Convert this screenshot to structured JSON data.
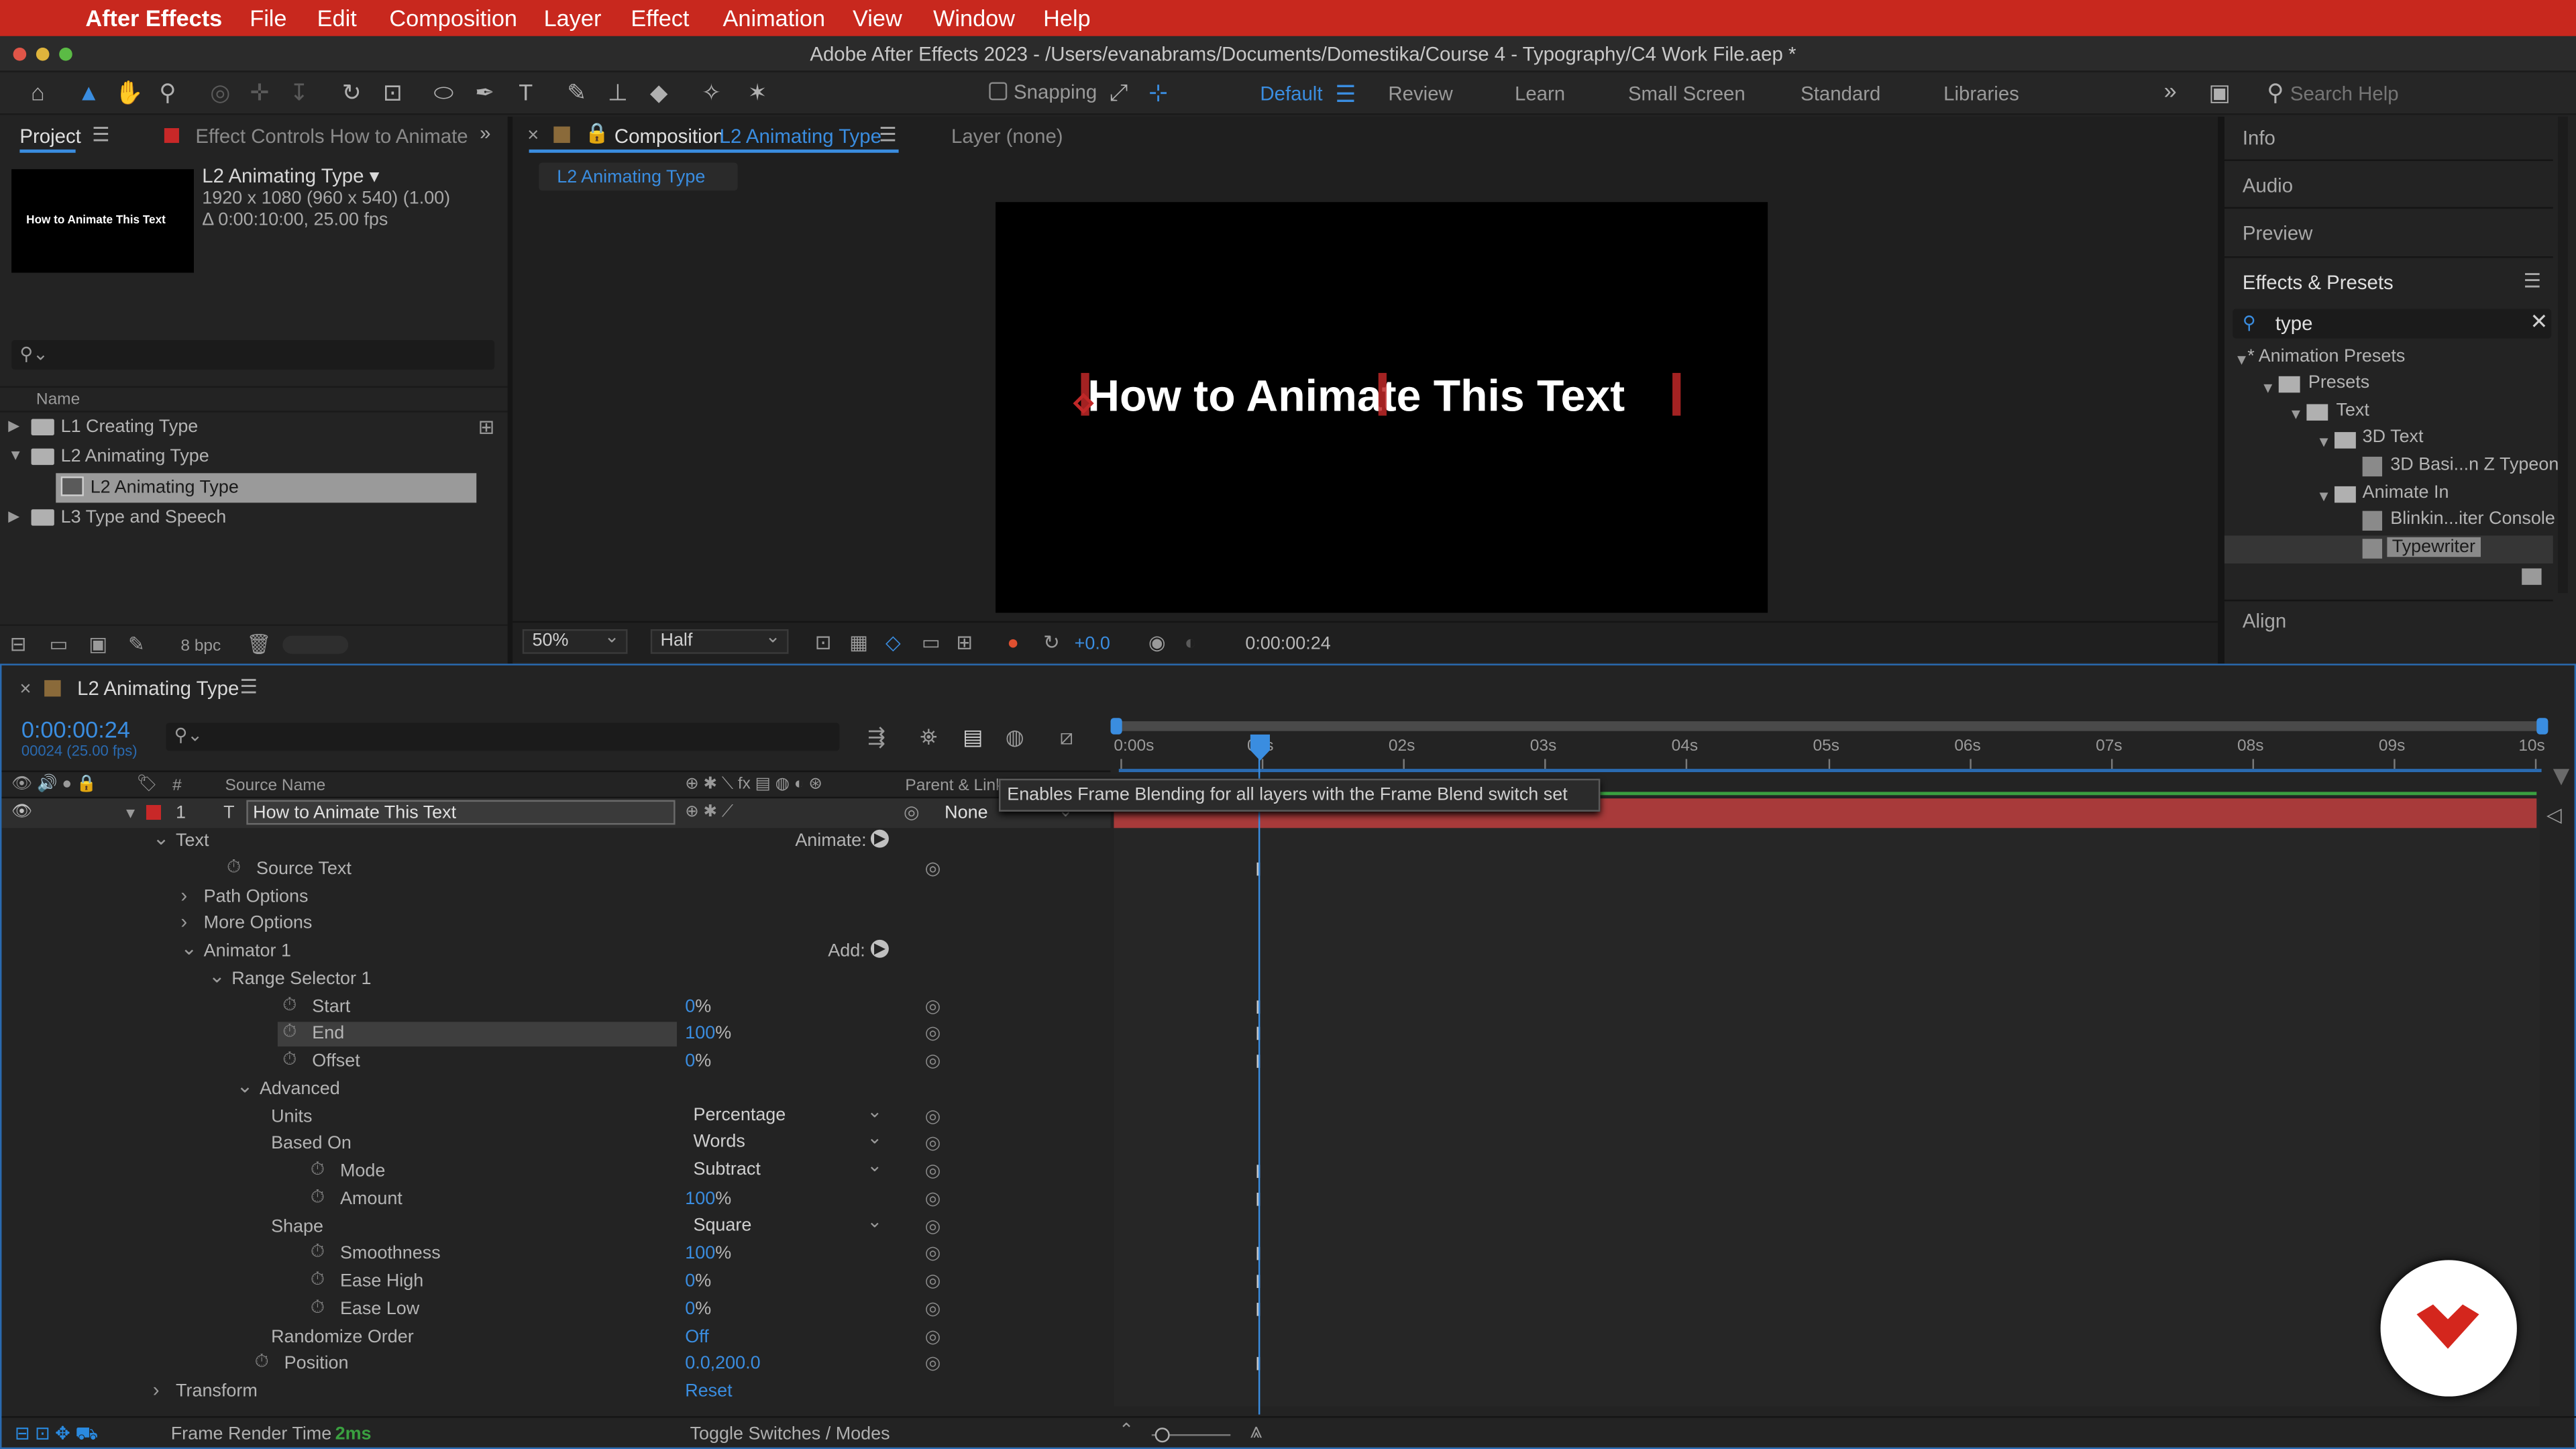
{
  "menubar": {
    "app": "After Effects",
    "items": [
      "File",
      "Edit",
      "Composition",
      "Layer",
      "Effect",
      "Animation",
      "View",
      "Window",
      "Help"
    ]
  },
  "titlebar": {
    "title": "Adobe After Effects 2023 - /Users/evanabrams/Documents/Domestika/Course 4 - Typography/C4 Work File.aep *"
  },
  "toolbar": {
    "snapping": "Snapping",
    "workspaces": [
      "Default",
      "Review",
      "Learn",
      "Small Screen",
      "Standard",
      "Libraries"
    ],
    "search_placeholder": "Search Help"
  },
  "project": {
    "tab": "Project",
    "tab2": "Effect Controls How to Animate",
    "thumb_text": "How to Animate This Text",
    "comp_name": "L2 Animating Type ▾",
    "comp_info1": "1920 x 1080  (960 x 540) (1.00)",
    "comp_info2": "Δ 0:00:10:00, 25.00 fps",
    "col_name": "Name",
    "items": [
      "L1 Creating Type",
      "L2 Animating Type",
      "L2 Animating Type",
      "L3 Type and Speech"
    ],
    "bpc": "8 bpc"
  },
  "comp": {
    "tab_prefix": "Composition",
    "tab_name": "L2 Animating Type",
    "layer_tab": "Layer (none)",
    "crumb": "L2 Animating Type",
    "canvas_text": "How to Animate This Text",
    "zoom": "50%",
    "quality": "Half",
    "exposure": "+0.0",
    "time": "0:00:00:24"
  },
  "right": {
    "info": "Info",
    "audio": "Audio",
    "preview": "Preview",
    "effects": "Effects & Presets",
    "search": "type",
    "tree": [
      "* Animation Presets",
      "Presets",
      "Text",
      "3D Text",
      "3D Basi...n Z Typeon",
      "Animate In",
      "Blinkin...iter Console",
      "Typewriter"
    ],
    "align": "Align"
  },
  "timeline": {
    "tab": "L2 Animating Type",
    "timecode": "0:00:00:24",
    "frames": "00024 (25.00 fps)",
    "col_num": "#",
    "col_source": "Source Name",
    "col_parent": "Parent & Link",
    "layer_num": "1",
    "layer_name": "How to Animate This Text",
    "parent": "None",
    "tooltip": "Enables Frame Blending for all layers with the Frame Blend switch set",
    "ruler": [
      "0:00s",
      "01s",
      "02s",
      "03s",
      "04s",
      "05s",
      "06s",
      "07s",
      "08s",
      "09s",
      "10s"
    ],
    "render_label": "Frame Render Time",
    "render_val": "2ms",
    "toggle": "Toggle Switches / Modes",
    "props": [
      {
        "name": "Text",
        "indent": 0,
        "tri": "v",
        "right": "Animate:"
      },
      {
        "name": "Source Text",
        "indent": 1,
        "sw": true
      },
      {
        "name": "Path Options",
        "indent": 1,
        "tri": ">"
      },
      {
        "name": "More Options",
        "indent": 1,
        "tri": ">"
      },
      {
        "name": "Animator 1",
        "indent": 1,
        "tri": "v",
        "right": "Add:"
      },
      {
        "name": "Range Selector 1",
        "indent": 2,
        "tri": "v"
      },
      {
        "name": "Start",
        "indent": 3,
        "sw": true,
        "val": "0",
        "unit": "%"
      },
      {
        "name": "End",
        "indent": 3,
        "sw": true,
        "val": "100",
        "unit": "%"
      },
      {
        "name": "Offset",
        "indent": 3,
        "sw": true,
        "val": "0",
        "unit": "%"
      },
      {
        "name": "Advanced",
        "indent": 3,
        "tri": "v"
      },
      {
        "name": "Units",
        "indent": 4,
        "dd": "Percentage"
      },
      {
        "name": "Based On",
        "indent": 4,
        "dd": "Words"
      },
      {
        "name": "Mode",
        "indent": 4,
        "sw": true,
        "dd": "Subtract"
      },
      {
        "name": "Amount",
        "indent": 4,
        "sw": true,
        "val": "100",
        "unit": "%"
      },
      {
        "name": "Shape",
        "indent": 4,
        "dd": "Square"
      },
      {
        "name": "Smoothness",
        "indent": 4,
        "sw": true,
        "val": "100",
        "unit": "%"
      },
      {
        "name": "Ease High",
        "indent": 4,
        "sw": true,
        "val": "0",
        "unit": "%"
      },
      {
        "name": "Ease Low",
        "indent": 4,
        "sw": true,
        "val": "0",
        "unit": "%"
      },
      {
        "name": "Randomize Order",
        "indent": 4,
        "val": "Off"
      },
      {
        "name": "Position",
        "indent": 2,
        "sw": true,
        "val": "0.0,200.0"
      },
      {
        "name": "Transform",
        "indent": 0,
        "tri": ">",
        "val": "Reset"
      }
    ]
  }
}
